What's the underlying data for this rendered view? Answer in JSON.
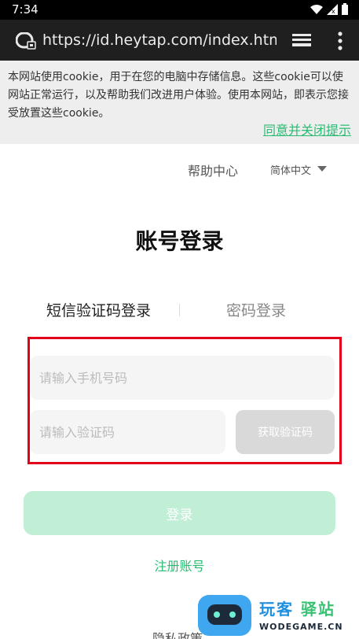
{
  "status_bar": {
    "time": "7:34"
  },
  "browser": {
    "url": "https://id.heytap.com/index.html?ca"
  },
  "cookie_banner": {
    "text": "本网站使用cookie，用于在您的电脑中存储信息。这些cookie可以使网站正常运行，以及帮助我们改进用户体验。使用本网站，即表示您接受放置这些cookie。",
    "close_link": "同意并关闭提示"
  },
  "header": {
    "help_center": "帮助中心",
    "language": "简体中文"
  },
  "page": {
    "title": "账号登录"
  },
  "tabs": [
    {
      "label": "短信验证码登录",
      "active": true
    },
    {
      "label": "密码登录",
      "active": false
    }
  ],
  "form": {
    "phone_placeholder": "请输入手机号码",
    "code_placeholder": "请输入验证码",
    "get_code_label": "获取验证码",
    "login_label": "登录"
  },
  "links": {
    "register": "注册账号",
    "privacy": "隐私政策"
  },
  "watermark": {
    "name_a": "玩客",
    "name_b": "驿站",
    "domain": "WODEGAME.CN"
  },
  "colors": {
    "accent": "#2bbb73",
    "login_disabled": "#c1efd6",
    "highlight_border": "#e3001b"
  }
}
